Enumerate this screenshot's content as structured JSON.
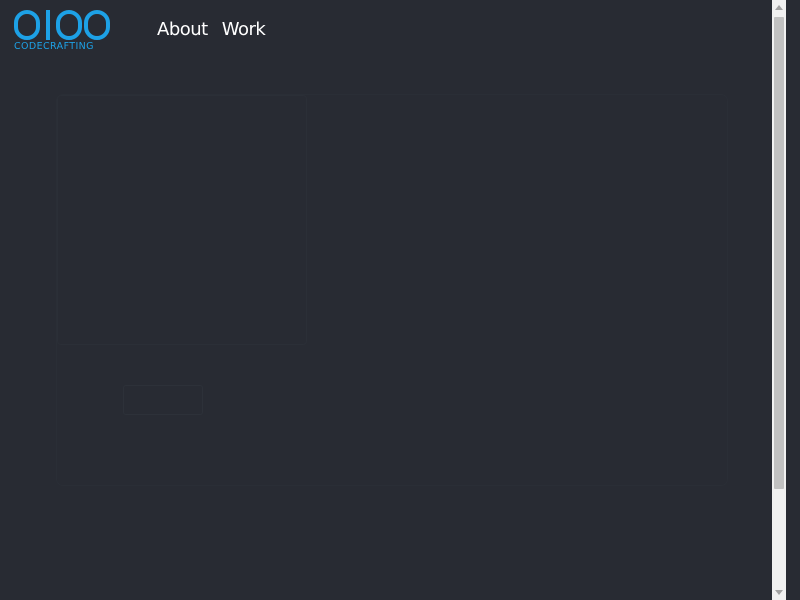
{
  "header": {
    "logo_text": "0100",
    "logo_subtitle": "CODECRAFTING",
    "nav": [
      {
        "label": "About"
      },
      {
        "label": "Work"
      }
    ]
  },
  "colors": {
    "background": "#282b33",
    "brand_blue": "#1da1e6",
    "nav_text": "#ffffff"
  },
  "icons": {
    "scroll_up": "chevron-up-icon",
    "scroll_down": "chevron-down-icon"
  }
}
